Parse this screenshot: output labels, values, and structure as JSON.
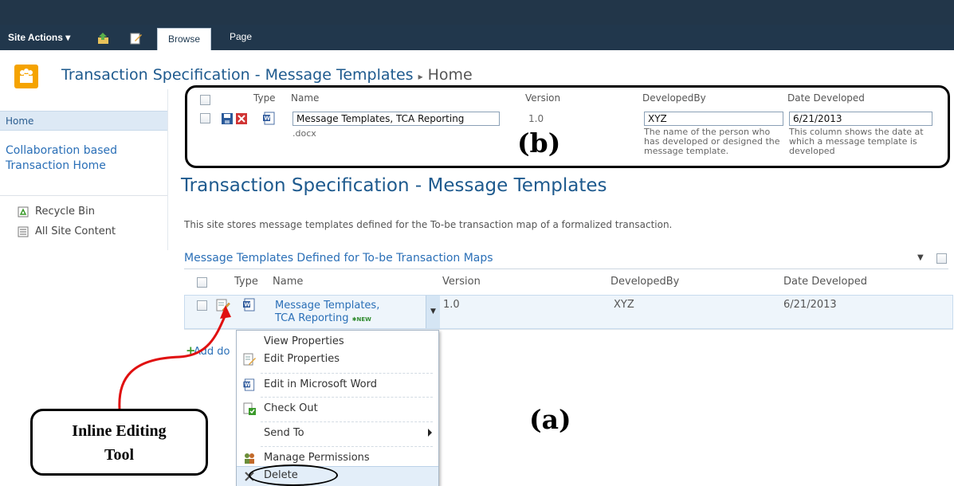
{
  "ribbon": {
    "site_actions": "Site Actions ▾",
    "tabs": [
      {
        "label": "Browse"
      },
      {
        "label": "Page"
      }
    ]
  },
  "breadcrumb": {
    "site": "Transaction Specification - Message Templates",
    "separator": "▸",
    "page": "Home"
  },
  "nav": {
    "home": "Home",
    "collab": "Collaboration based Transaction Home",
    "recycle_bin": "Recycle Bin",
    "all_site_content": "All Site Content"
  },
  "main": {
    "heading": "Transaction Specification - Message Templates",
    "description": "This site stores message templates defined for the To-be transaction map of a formalized transaction.",
    "list_title": "Message Templates Defined for To-be Transaction Maps",
    "columns": [
      "Type",
      "Name",
      "Version",
      "DevelopedBy",
      "Date Developed"
    ],
    "row": {
      "name_line1": "Message Templates,",
      "name_line2": "TCA Reporting",
      "new_badge": "NEW",
      "version": "1.0",
      "developed_by": "XYZ",
      "date": "6/21/2013"
    },
    "add_document": "Add do"
  },
  "menu": {
    "items": [
      "View Properties",
      "Edit Properties",
      "Edit in Microsoft Word",
      "Check Out",
      "Send To",
      "Manage Permissions",
      "Delete"
    ]
  },
  "inline_edit": {
    "columns": [
      "Type",
      "Name",
      "Version",
      "DevelopedBy",
      "Date Developed"
    ],
    "name_value": "Message Templates, TCA Reporting",
    "extension": ".docx",
    "version": "1.0",
    "developed_by_value": "XYZ",
    "date_value": "6/21/2013",
    "developed_by_help": "The name of the person who has developed or designed the message template.",
    "date_help": "This column shows the date at which a message template is developed"
  },
  "annotations": {
    "label_a": "(a)",
    "label_b": "(b)",
    "callout": "Inline Editing Tool"
  },
  "colors": {
    "ribbon": "#21374c",
    "link": "#2a6fb7",
    "heading": "#1e5a8e",
    "logo": "#f5a300"
  }
}
